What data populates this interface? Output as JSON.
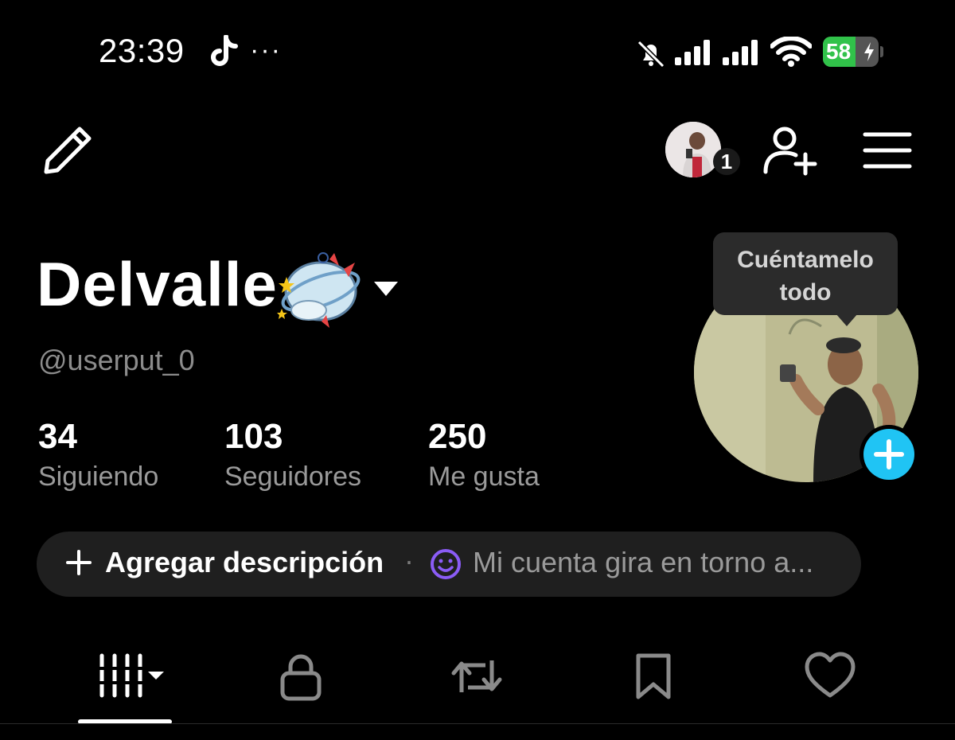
{
  "status_bar": {
    "time": "23:39",
    "overflow": "···",
    "battery_level": "58",
    "battery_percent": 58,
    "battery_color": "#31c24a",
    "icons": [
      "tiktok-icon",
      "bell-muted-icon",
      "signal-icon",
      "signal-icon",
      "wifi-icon",
      "battery-charging-icon"
    ]
  },
  "header": {
    "notification_count": "1",
    "icons": [
      "pencil-icon",
      "add-user-icon",
      "hamburger-menu-icon"
    ]
  },
  "profile": {
    "display_name": "Delvalle",
    "username": "@userput_0",
    "stats": [
      {
        "value": "34",
        "label": "Siguiendo"
      },
      {
        "value": "103",
        "label": "Seguidores"
      },
      {
        "value": "250",
        "label": "Me gusta"
      }
    ],
    "tooltip": "Cuéntamelo\ntodo",
    "accent_color": "#20c4f4"
  },
  "bio": {
    "add_label": "Agregar descripción",
    "separator": "·",
    "hint": "Mi cuenta gira en torno a..."
  },
  "tabs": [
    {
      "name": "videos",
      "icon": "grid-icon",
      "selected": true
    },
    {
      "name": "private",
      "icon": "lock-icon"
    },
    {
      "name": "reposts",
      "icon": "repost-icon"
    },
    {
      "name": "favorites",
      "icon": "bookmark-icon"
    },
    {
      "name": "liked",
      "icon": "heart-icon"
    }
  ]
}
